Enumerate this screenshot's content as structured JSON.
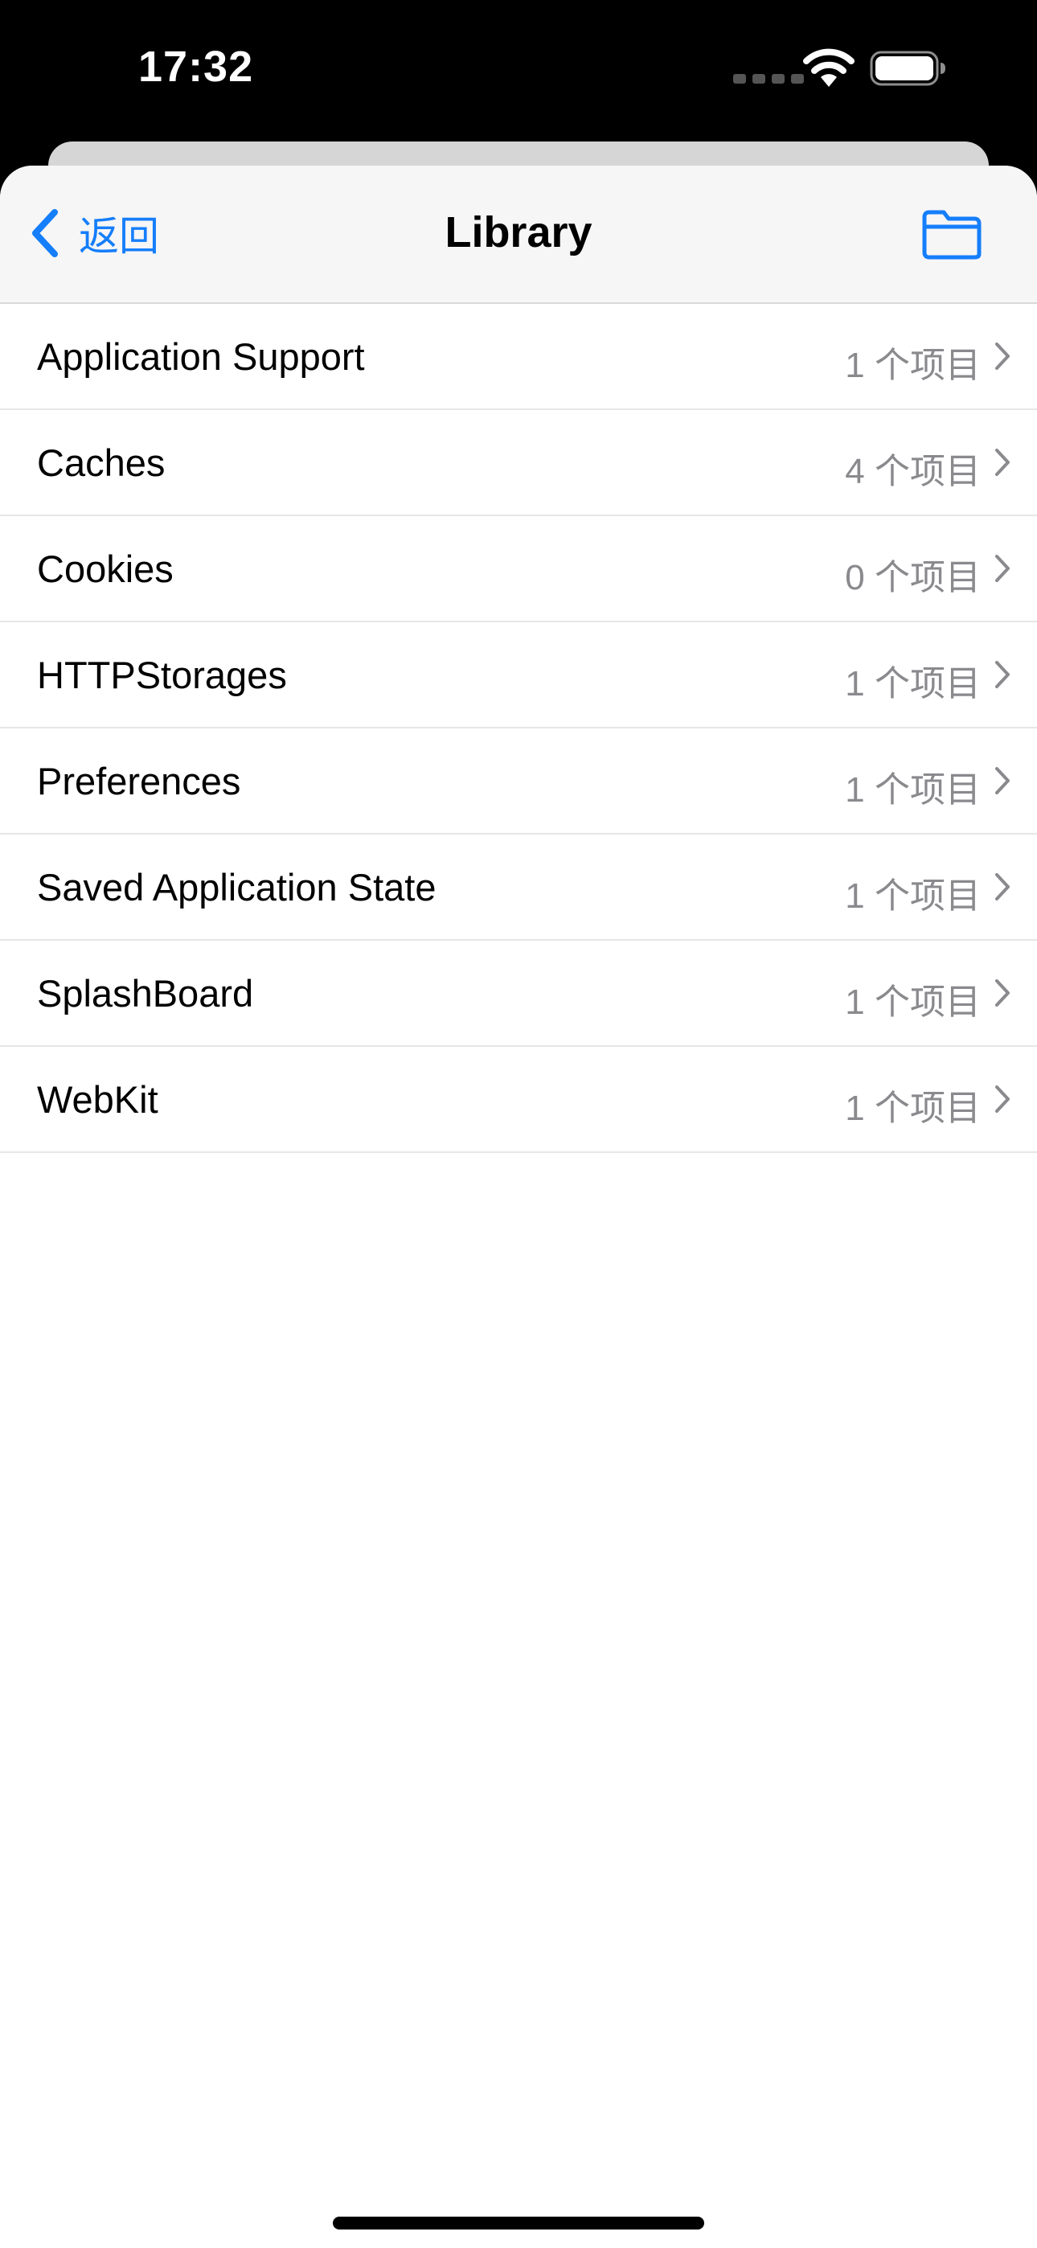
{
  "status_bar": {
    "time": "17:32",
    "icons": [
      "cellular-signal-icon",
      "wifi-icon",
      "battery-icon"
    ]
  },
  "nav": {
    "back_label": "返回",
    "title": "Library",
    "right_icon": "folder-icon"
  },
  "colors": {
    "accent": "#157efb",
    "secondary_text": "#8a8a8e",
    "nav_background": "#f6f6f6",
    "separator": "#e6e6e6"
  },
  "items": [
    {
      "name": "Application Support",
      "count": "1 个项目"
    },
    {
      "name": "Caches",
      "count": "4 个项目"
    },
    {
      "name": "Cookies",
      "count": "0 个项目"
    },
    {
      "name": "HTTPStorages",
      "count": "1 个项目"
    },
    {
      "name": "Preferences",
      "count": "1 个项目"
    },
    {
      "name": "Saved Application State",
      "count": "1 个项目"
    },
    {
      "name": "SplashBoard",
      "count": "1 个项目"
    },
    {
      "name": "WebKit",
      "count": "1 个项目"
    }
  ]
}
